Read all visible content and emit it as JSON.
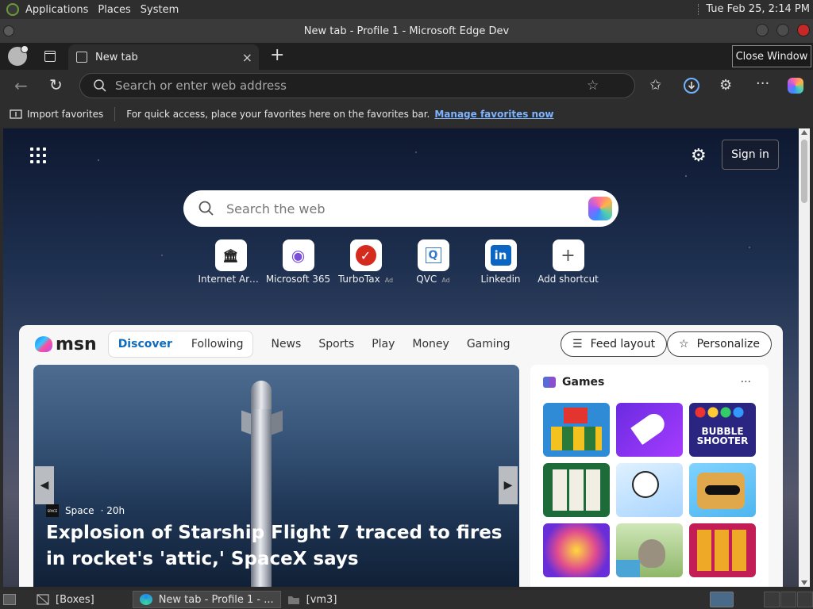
{
  "top_panel": {
    "menus": [
      "Applications",
      "Places",
      "System"
    ],
    "clock": "Tue Feb 25,  2:14 PM"
  },
  "window": {
    "title": "New tab - Profile 1 - Microsoft Edge Dev",
    "tooltip": "Close Window"
  },
  "tabs": [
    {
      "label": "New tab",
      "close": "×"
    }
  ],
  "new_tab_symbol": "+",
  "toolbar": {
    "address_placeholder": "Search or enter web address"
  },
  "favorites_bar": {
    "import_label": "Import favorites",
    "message": "For quick access, place your favorites here on the favorites bar.",
    "manage_link": "Manage favorites now"
  },
  "new_tab_page": {
    "signin_label": "Sign in",
    "search_placeholder": "Search the web",
    "shortcuts": [
      {
        "label": "Internet Arc…",
        "glyph": "🏛",
        "ad": ""
      },
      {
        "label": "Microsoft 365",
        "glyph": "◉",
        "ad": ""
      },
      {
        "label": "TurboTax",
        "glyph": "✓",
        "ad": "Ad"
      },
      {
        "label": "QVC",
        "glyph": "Q",
        "ad": "Ad"
      },
      {
        "label": "Linkedin",
        "glyph": "in",
        "ad": ""
      },
      {
        "label": "Add shortcut",
        "glyph": "+",
        "ad": ""
      }
    ]
  },
  "feed": {
    "logo_text": "msn",
    "segments": {
      "discover": "Discover",
      "following": "Following"
    },
    "links": [
      "News",
      "Sports",
      "Play",
      "Money",
      "Gaming"
    ],
    "more": "···",
    "feed_layout_label": "Feed layout",
    "personalize_label": "Personalize",
    "hero": {
      "source_logo": "SPACE",
      "source": "Space",
      "age": "· 20h",
      "title": "Explosion of Starship Flight 7 traced to fires in rocket's 'attic,' SpaceX says",
      "prev": "◀",
      "next": "▶"
    },
    "games": {
      "title": "Games",
      "more": "···"
    }
  },
  "taskbar": {
    "tasks": [
      "[Boxes]",
      "New tab - Profile 1 - ...",
      "[vm3]"
    ]
  }
}
